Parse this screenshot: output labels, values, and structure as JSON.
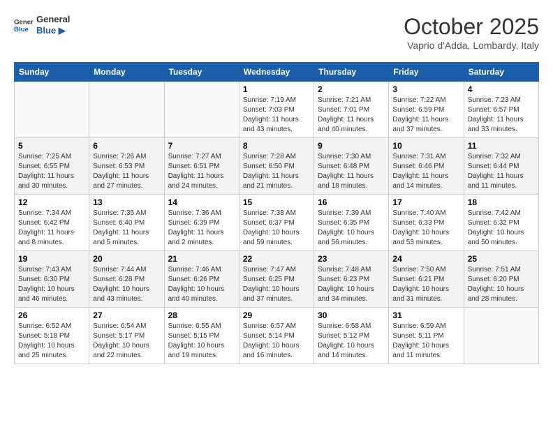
{
  "header": {
    "logo_line1": "General",
    "logo_line2": "Blue",
    "month": "October 2025",
    "location": "Vaprio d'Adda, Lombardy, Italy"
  },
  "days_of_week": [
    "Sunday",
    "Monday",
    "Tuesday",
    "Wednesday",
    "Thursday",
    "Friday",
    "Saturday"
  ],
  "weeks": [
    [
      {
        "day": "",
        "content": ""
      },
      {
        "day": "",
        "content": ""
      },
      {
        "day": "",
        "content": ""
      },
      {
        "day": "1",
        "content": "Sunrise: 7:19 AM\nSunset: 7:03 PM\nDaylight: 11 hours and 43 minutes."
      },
      {
        "day": "2",
        "content": "Sunrise: 7:21 AM\nSunset: 7:01 PM\nDaylight: 11 hours and 40 minutes."
      },
      {
        "day": "3",
        "content": "Sunrise: 7:22 AM\nSunset: 6:59 PM\nDaylight: 11 hours and 37 minutes."
      },
      {
        "day": "4",
        "content": "Sunrise: 7:23 AM\nSunset: 6:57 PM\nDaylight: 11 hours and 33 minutes."
      }
    ],
    [
      {
        "day": "5",
        "content": "Sunrise: 7:25 AM\nSunset: 6:55 PM\nDaylight: 11 hours and 30 minutes."
      },
      {
        "day": "6",
        "content": "Sunrise: 7:26 AM\nSunset: 6:53 PM\nDaylight: 11 hours and 27 minutes."
      },
      {
        "day": "7",
        "content": "Sunrise: 7:27 AM\nSunset: 6:51 PM\nDaylight: 11 hours and 24 minutes."
      },
      {
        "day": "8",
        "content": "Sunrise: 7:28 AM\nSunset: 6:50 PM\nDaylight: 11 hours and 21 minutes."
      },
      {
        "day": "9",
        "content": "Sunrise: 7:30 AM\nSunset: 6:48 PM\nDaylight: 11 hours and 18 minutes."
      },
      {
        "day": "10",
        "content": "Sunrise: 7:31 AM\nSunset: 6:46 PM\nDaylight: 11 hours and 14 minutes."
      },
      {
        "day": "11",
        "content": "Sunrise: 7:32 AM\nSunset: 6:44 PM\nDaylight: 11 hours and 11 minutes."
      }
    ],
    [
      {
        "day": "12",
        "content": "Sunrise: 7:34 AM\nSunset: 6:42 PM\nDaylight: 11 hours and 8 minutes."
      },
      {
        "day": "13",
        "content": "Sunrise: 7:35 AM\nSunset: 6:40 PM\nDaylight: 11 hours and 5 minutes."
      },
      {
        "day": "14",
        "content": "Sunrise: 7:36 AM\nSunset: 6:39 PM\nDaylight: 11 hours and 2 minutes."
      },
      {
        "day": "15",
        "content": "Sunrise: 7:38 AM\nSunset: 6:37 PM\nDaylight: 10 hours and 59 minutes."
      },
      {
        "day": "16",
        "content": "Sunrise: 7:39 AM\nSunset: 6:35 PM\nDaylight: 10 hours and 56 minutes."
      },
      {
        "day": "17",
        "content": "Sunrise: 7:40 AM\nSunset: 6:33 PM\nDaylight: 10 hours and 53 minutes."
      },
      {
        "day": "18",
        "content": "Sunrise: 7:42 AM\nSunset: 6:32 PM\nDaylight: 10 hours and 50 minutes."
      }
    ],
    [
      {
        "day": "19",
        "content": "Sunrise: 7:43 AM\nSunset: 6:30 PM\nDaylight: 10 hours and 46 minutes."
      },
      {
        "day": "20",
        "content": "Sunrise: 7:44 AM\nSunset: 6:28 PM\nDaylight: 10 hours and 43 minutes."
      },
      {
        "day": "21",
        "content": "Sunrise: 7:46 AM\nSunset: 6:26 PM\nDaylight: 10 hours and 40 minutes."
      },
      {
        "day": "22",
        "content": "Sunrise: 7:47 AM\nSunset: 6:25 PM\nDaylight: 10 hours and 37 minutes."
      },
      {
        "day": "23",
        "content": "Sunrise: 7:48 AM\nSunset: 6:23 PM\nDaylight: 10 hours and 34 minutes."
      },
      {
        "day": "24",
        "content": "Sunrise: 7:50 AM\nSunset: 6:21 PM\nDaylight: 10 hours and 31 minutes."
      },
      {
        "day": "25",
        "content": "Sunrise: 7:51 AM\nSunset: 6:20 PM\nDaylight: 10 hours and 28 minutes."
      }
    ],
    [
      {
        "day": "26",
        "content": "Sunrise: 6:52 AM\nSunset: 5:18 PM\nDaylight: 10 hours and 25 minutes."
      },
      {
        "day": "27",
        "content": "Sunrise: 6:54 AM\nSunset: 5:17 PM\nDaylight: 10 hours and 22 minutes."
      },
      {
        "day": "28",
        "content": "Sunrise: 6:55 AM\nSunset: 5:15 PM\nDaylight: 10 hours and 19 minutes."
      },
      {
        "day": "29",
        "content": "Sunrise: 6:57 AM\nSunset: 5:14 PM\nDaylight: 10 hours and 16 minutes."
      },
      {
        "day": "30",
        "content": "Sunrise: 6:58 AM\nSunset: 5:12 PM\nDaylight: 10 hours and 14 minutes."
      },
      {
        "day": "31",
        "content": "Sunrise: 6:59 AM\nSunset: 5:11 PM\nDaylight: 10 hours and 11 minutes."
      },
      {
        "day": "",
        "content": ""
      }
    ]
  ]
}
